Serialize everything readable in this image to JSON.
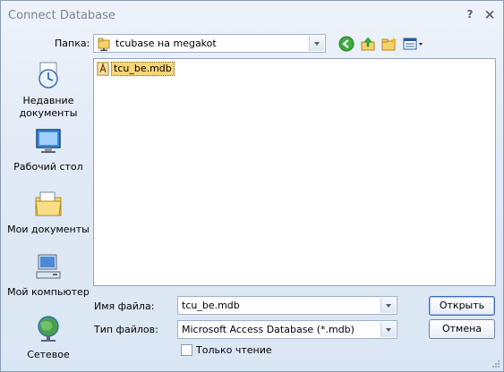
{
  "window": {
    "title": "Connect Database",
    "help_label": "?",
    "close_label": "×"
  },
  "lookin": {
    "label": "Папка:",
    "value": "tcubase на megakot"
  },
  "toolbar": {
    "icons": [
      "back-icon",
      "up-folder-icon",
      "new-folder-icon",
      "views-menu-icon"
    ]
  },
  "places": [
    {
      "label": "Недавние документы",
      "icon": "recent-documents-icon"
    },
    {
      "label": "Рабочий стол",
      "icon": "desktop-icon"
    },
    {
      "label": "Мои документы",
      "icon": "my-documents-icon"
    },
    {
      "label": "Мой компьютер",
      "icon": "my-computer-icon"
    },
    {
      "label": "Сетевое",
      "icon": "network-icon"
    }
  ],
  "files": [
    {
      "name": "tcu_be.mdb",
      "selected": true
    }
  ],
  "filename": {
    "label": "Имя файла:",
    "value": "tcu_be.mdb"
  },
  "filetype": {
    "label": "Тип файлов:",
    "value": "Microsoft Access Database (*.mdb)"
  },
  "readonly": {
    "label": "Только чтение",
    "checked": false
  },
  "buttons": {
    "open": "Открыть",
    "cancel": "Отмена"
  },
  "colors": {
    "selection": "#f8d57a",
    "border": "#8ea5c8",
    "accent": "#3c6bb5"
  }
}
